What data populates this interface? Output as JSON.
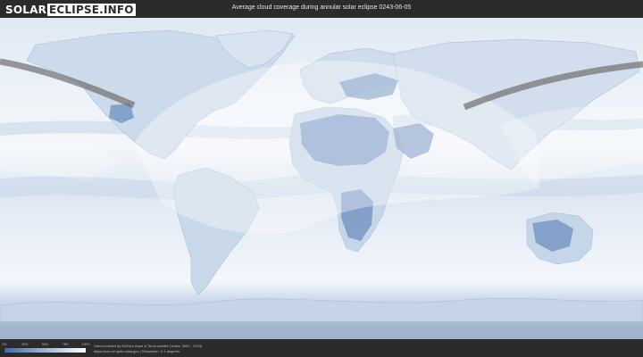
{
  "header": {
    "logo_part1": "SOLAR",
    "logo_part2": "ECLIPSE.INFO",
    "title": "Average cloud coverage during annular solar eclipse 0243-06-05"
  },
  "map": {
    "ocean_color": "#e9f0f8",
    "land_color": "#c8d8ea",
    "clear_region_color": "#6e8fbf",
    "eclipse_path_color": "#6f6f6f",
    "visibility_zone_color": "#ffffff"
  },
  "footer": {
    "colorbar": {
      "ticks": [
        "0%",
        "25%",
        "50%",
        "75%",
        "100%"
      ],
      "color_low": "#3f6aa8",
      "color_high": "#ffffff"
    },
    "credit_line1": "Data provided by NASA's Aqua & Terra satellite (Years: 2000 - 2019)",
    "credit_line2": "https://neo.sci.gsfc.nasa.gov  |  Resolution: 0.1 degrees"
  }
}
